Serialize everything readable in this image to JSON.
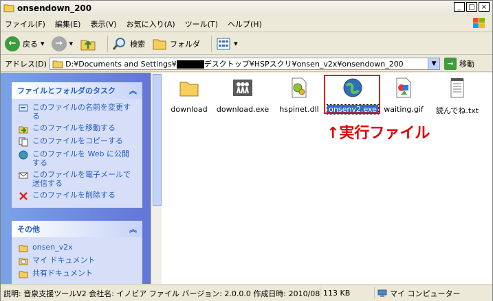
{
  "window": {
    "title": "onsendown_200"
  },
  "menu": [
    "ファイル(F)",
    "編集(E)",
    "表示(V)",
    "お気に入り(A)",
    "ツール(T)",
    "ヘルプ(H)"
  ],
  "toolbar": {
    "back_label": "戻る",
    "search_label": "検索",
    "folders_label": "フォルダ"
  },
  "address": {
    "label": "アドレス(D)",
    "path_prefix": "D:¥Documents and Settings¥",
    "path_suffix": "デスクトップ¥HSPスクリ¥onsen_v2x¥onsendown_200",
    "go_label": "移動"
  },
  "tasks": {
    "title": "ファイルとフォルダのタスク",
    "items": [
      "このファイルの名前を変更する",
      "このファイルを移動する",
      "このファイルをコピーする",
      "このファイルを Web に公開する",
      "このファイルを電子メールで送信する",
      "このファイルを削除する"
    ]
  },
  "other": {
    "title": "その他",
    "items": [
      "onsen_v2x",
      "マイ ドキュメント",
      "共有ドキュメント"
    ]
  },
  "files": [
    {
      "name": "download",
      "icon": "folder-icon"
    },
    {
      "name": "download.exe",
      "icon": "exe-icon"
    },
    {
      "name": "hspinet.dll",
      "icon": "dll-icon"
    },
    {
      "name": "onsenv2.exe",
      "icon": "globe-icon",
      "selected": true
    },
    {
      "name": "waiting.gif",
      "icon": "image-icon"
    },
    {
      "name": "読んでね.txt",
      "icon": "text-file-icon"
    }
  ],
  "annotation": "↑実行ファイル",
  "status": {
    "description": "説明: 音泉支援ツールV2 会社名: イノビア ファイル バージョン: 2.0.0.0 作成日時: 2010/08/22 2",
    "size": "113 KB",
    "location": "マイ コンピューター"
  },
  "colors": {
    "annotation": "#e00000",
    "selection": "#316ac5",
    "panel_link": "#215dc6"
  }
}
